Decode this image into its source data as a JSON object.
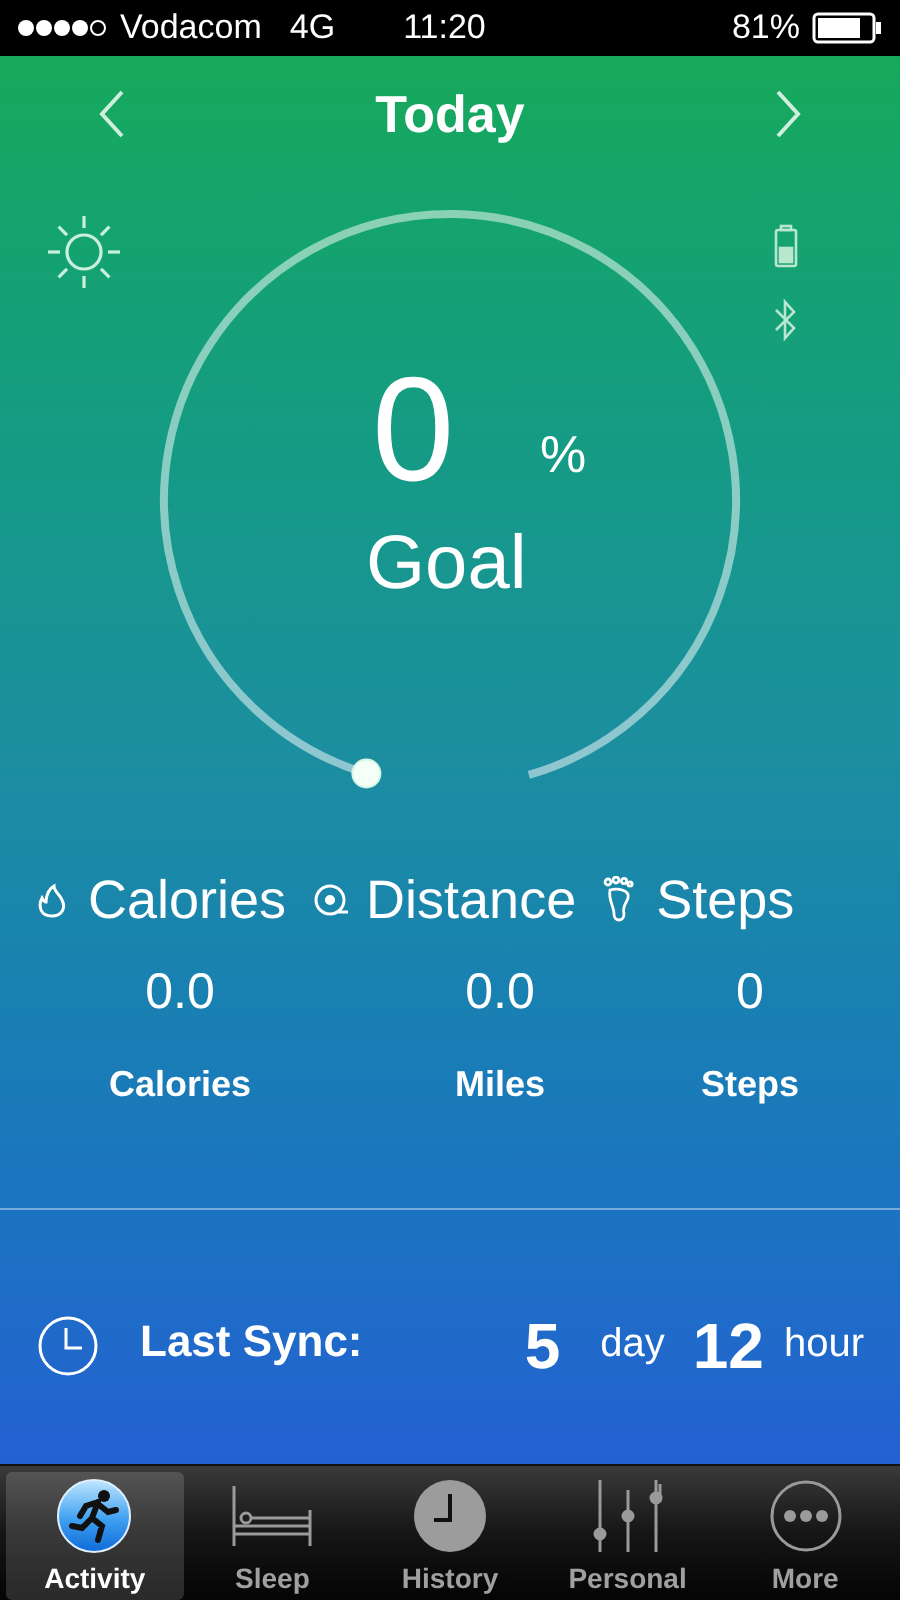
{
  "status_bar": {
    "carrier": "Vodacom",
    "network": "4G",
    "time": "11:20",
    "battery": "81%"
  },
  "header": {
    "title": "Today"
  },
  "goal": {
    "value": "0",
    "unit": "%",
    "label": "Goal"
  },
  "stats": [
    {
      "kind": "calories",
      "heading": "Calories",
      "value": "0.0",
      "unit": "Calories"
    },
    {
      "kind": "distance",
      "heading": "Distance",
      "value": "0.0",
      "unit": "Miles"
    },
    {
      "kind": "steps",
      "heading": "Steps",
      "value": "0",
      "unit": "Steps"
    }
  ],
  "sync": {
    "label": "Last Sync:",
    "days": "5",
    "day_unit": "day",
    "hours": "12",
    "hour_unit": "hour"
  },
  "tabs": [
    {
      "kind": "activity",
      "label": "Activity",
      "selected": true
    },
    {
      "kind": "sleep",
      "label": "Sleep",
      "selected": false
    },
    {
      "kind": "history",
      "label": "History",
      "selected": false
    },
    {
      "kind": "personal",
      "label": "Personal",
      "selected": false
    },
    {
      "kind": "more",
      "label": "More",
      "selected": false
    }
  ]
}
